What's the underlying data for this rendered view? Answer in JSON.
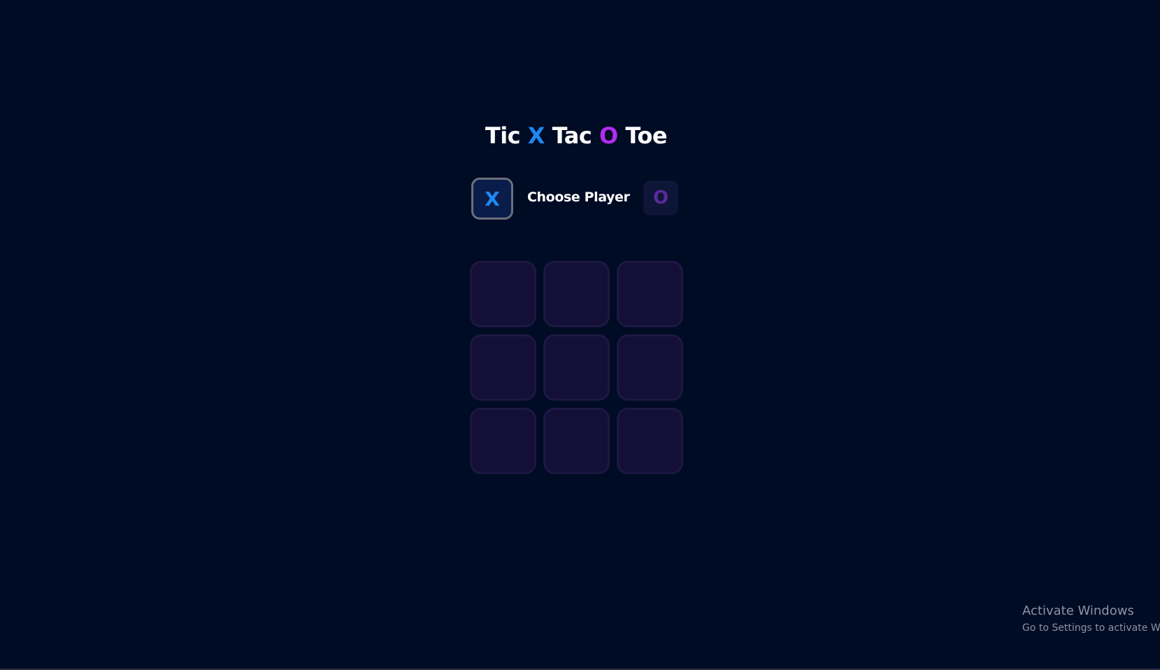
{
  "title": {
    "part1": "Tic",
    "x_mark": "X",
    "part2": "Tac",
    "o_mark": "O",
    "part3": "Toe"
  },
  "player_chooser": {
    "x_option": "X",
    "label": "Choose Player",
    "o_option": "O",
    "selected": "X"
  },
  "board": {
    "cells": [
      "",
      "",
      "",
      "",
      "",
      "",
      "",
      "",
      ""
    ]
  },
  "watermark": {
    "line1": "Activate Windows",
    "line2": "Go to Settings to activate Windows."
  },
  "colors": {
    "background": "#000b24",
    "x_accent": "#1e88f0",
    "o_accent": "#b22cf0",
    "cell_fill": "#130f36"
  }
}
